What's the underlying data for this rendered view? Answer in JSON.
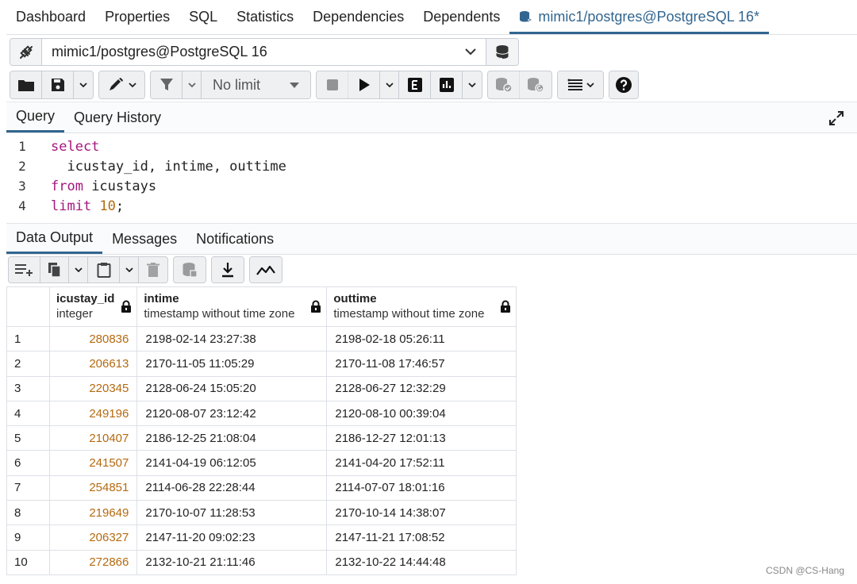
{
  "top_tabs": [
    "Dashboard",
    "Properties",
    "SQL",
    "Statistics",
    "Dependencies",
    "Dependents"
  ],
  "active_tab": "mimic1/postgres@PostgreSQL 16*",
  "connection": {
    "value": "mimic1/postgres@PostgreSQL 16"
  },
  "toolbar": {
    "limit_label": "No limit"
  },
  "query_tabs": [
    "Query",
    "Query History"
  ],
  "editor": {
    "line_numbers": [
      "1",
      "2",
      "3",
      "4"
    ],
    "kw_select": "select",
    "line2": "  icustay_id, intime, outtime",
    "kw_from": "from",
    "table": " icustays",
    "kw_limit": "limit",
    "limit_value": "10",
    "semicolon": ";"
  },
  "output_tabs": [
    "Data Output",
    "Messages",
    "Notifications"
  ],
  "grid": {
    "columns": [
      {
        "name": "icustay_id",
        "type": "integer"
      },
      {
        "name": "intime",
        "type": "timestamp without time zone"
      },
      {
        "name": "outtime",
        "type": "timestamp without time zone"
      }
    ],
    "rows": [
      [
        "1",
        "280836",
        "2198-02-14 23:27:38",
        "2198-02-18 05:26:11"
      ],
      [
        "2",
        "206613",
        "2170-11-05 11:05:29",
        "2170-11-08 17:46:57"
      ],
      [
        "3",
        "220345",
        "2128-06-24 15:05:20",
        "2128-06-27 12:32:29"
      ],
      [
        "4",
        "249196",
        "2120-08-07 23:12:42",
        "2120-08-10 00:39:04"
      ],
      [
        "5",
        "210407",
        "2186-12-25 21:08:04",
        "2186-12-27 12:01:13"
      ],
      [
        "6",
        "241507",
        "2141-04-19 06:12:05",
        "2141-04-20 17:52:11"
      ],
      [
        "7",
        "254851",
        "2114-06-28 22:28:44",
        "2114-07-07 18:01:16"
      ],
      [
        "8",
        "219649",
        "2170-10-07 11:28:53",
        "2170-10-14 14:38:07"
      ],
      [
        "9",
        "206327",
        "2147-11-20 09:02:23",
        "2147-11-21 17:08:52"
      ],
      [
        "10",
        "272866",
        "2132-10-21 21:11:46",
        "2132-10-22 14:44:48"
      ]
    ]
  },
  "watermark": "CSDN @CS-Hang",
  "colors": {
    "accent": "#326690",
    "keyword": "#a5167e",
    "number": "#b46a10"
  }
}
